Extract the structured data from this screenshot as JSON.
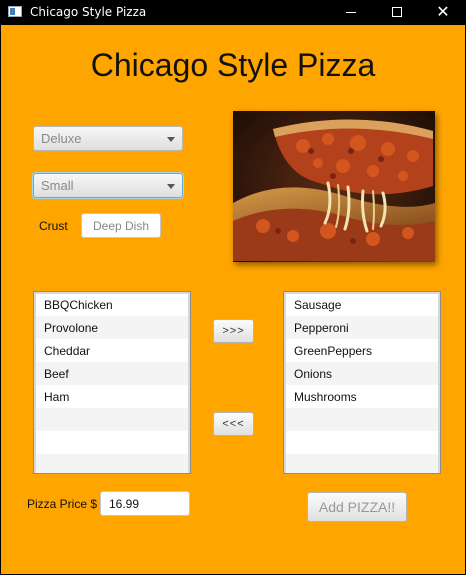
{
  "window": {
    "title": "Chicago Style Pizza",
    "minimize_icon": "minimize-icon",
    "maximize_icon": "maximize-icon",
    "close_icon": "close-icon",
    "close_glyph": "✕"
  },
  "heading": "Chicago Style Pizza",
  "pizza_type": {
    "selected": "Deluxe"
  },
  "pizza_size": {
    "selected": "Small"
  },
  "crust": {
    "label": "Crust",
    "value": "Deep Dish"
  },
  "available_toppings": [
    "BBQChicken",
    "Provolone",
    "Cheddar",
    "Beef",
    "Ham",
    "",
    "",
    ""
  ],
  "selected_toppings": [
    "Sausage",
    "Pepperoni",
    "GreenPeppers",
    "Onions",
    "Mushrooms",
    "",
    "",
    ""
  ],
  "buttons": {
    "add_topping": ">>>",
    "remove_topping": "<<<",
    "add_pizza": "Add PIZZA!!"
  },
  "price": {
    "label": "Pizza Price $",
    "value": "16.99"
  },
  "colors": {
    "background": "#ffa500",
    "titlebar": "#000000"
  }
}
